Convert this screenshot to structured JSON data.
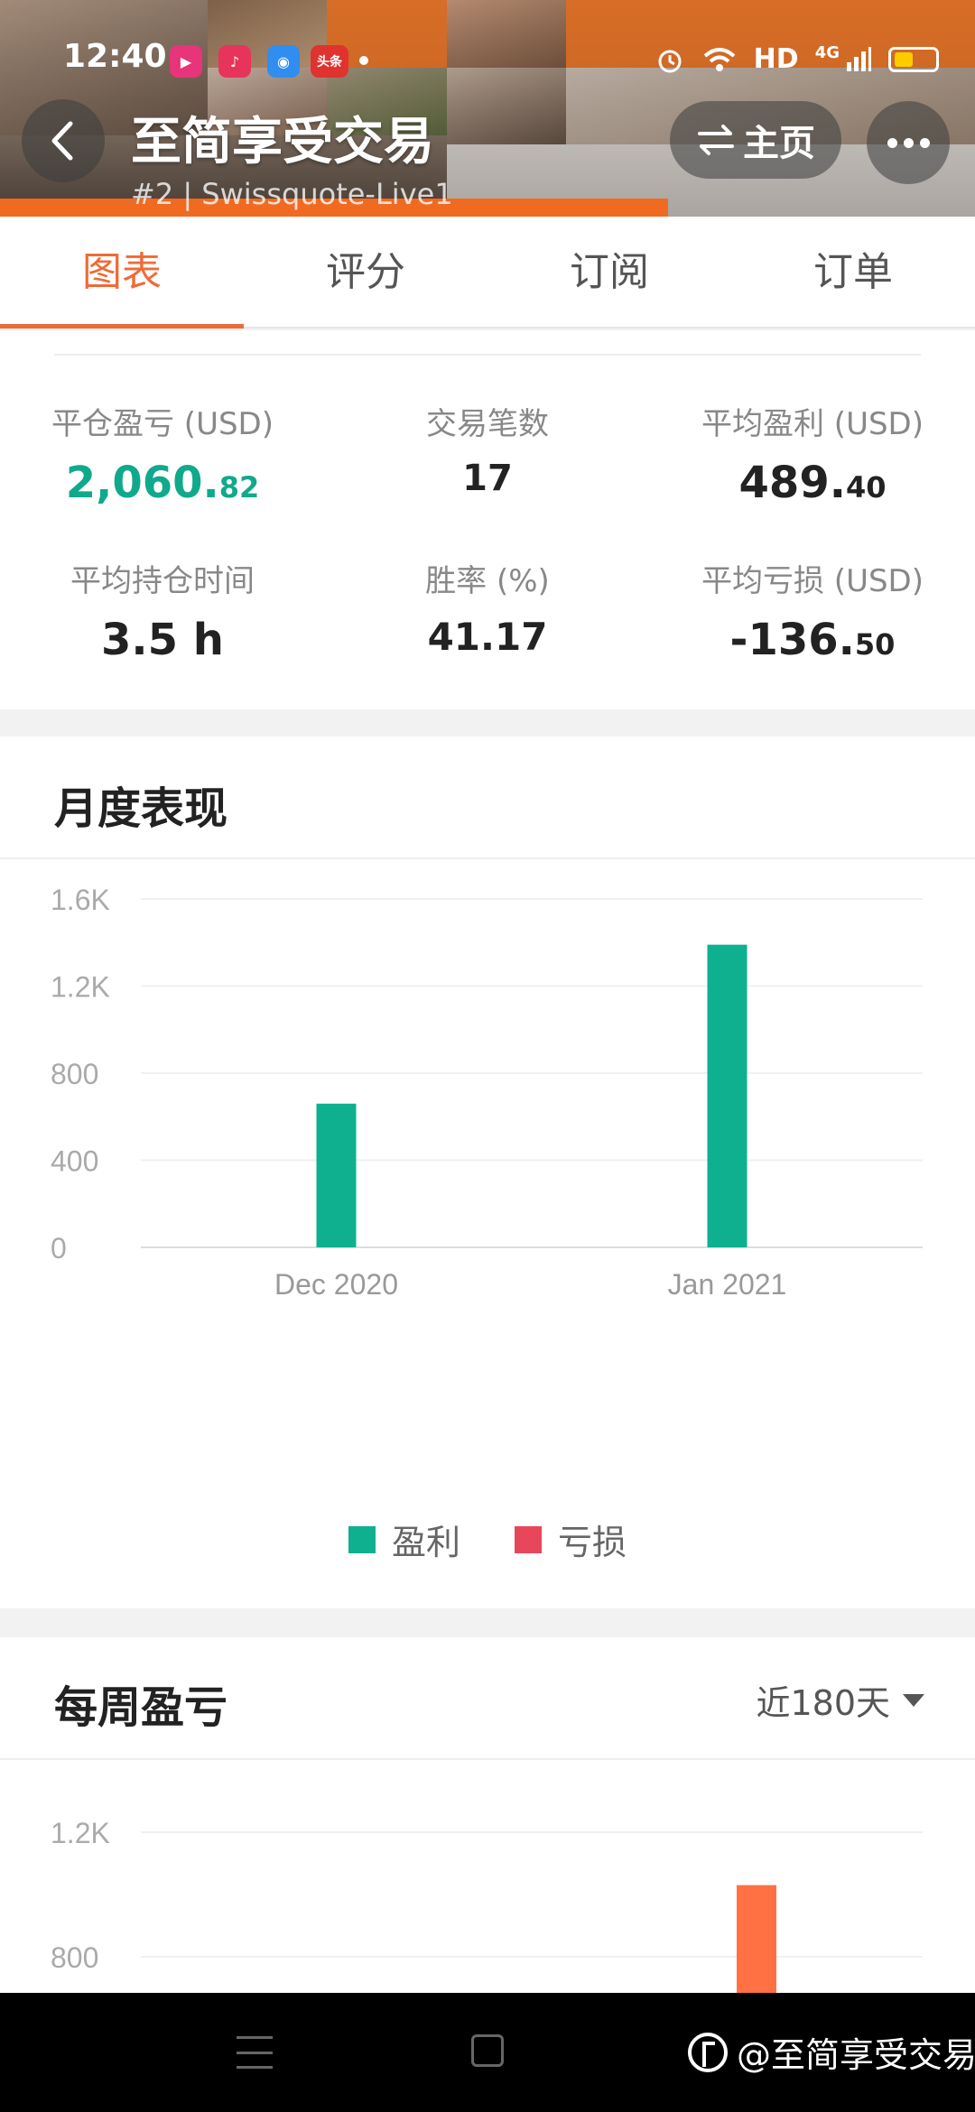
{
  "status_bar": {
    "time": "12:40",
    "network": "HD",
    "signal": "4G",
    "apps": [
      {
        "icon": "video-app-icon",
        "color": "#e8347a",
        "label": "▶"
      },
      {
        "icon": "music-app-icon",
        "color": "#e8345a",
        "label": "♪"
      },
      {
        "icon": "browser-app-icon",
        "color": "#2f8ef0",
        "label": "◉"
      },
      {
        "icon": "news-app-icon",
        "color": "#e0332f",
        "label": "头条"
      }
    ]
  },
  "header": {
    "title": "至简享受交易",
    "subtitle": "#2 | Swissquote-Live1",
    "home_label": "主页",
    "home_icon": "swap-icon"
  },
  "tabs": [
    {
      "label": "图表",
      "active": true
    },
    {
      "label": "评分",
      "active": false
    },
    {
      "label": "订阅",
      "active": false
    },
    {
      "label": "订单",
      "active": false
    }
  ],
  "stats": [
    {
      "label": "平仓盈亏 (USD)",
      "value_main": "2,060.",
      "value_small": "82",
      "color": "#10a98c"
    },
    {
      "label": "交易笔数",
      "value_main": "17",
      "value_small": ""
    },
    {
      "label": "平均盈利 (USD)",
      "value_main": "489.",
      "value_small": "40"
    },
    {
      "label": "平均持仓时间",
      "value_main": "3.5 h",
      "value_small": ""
    },
    {
      "label": "胜率 (%)",
      "value_main": "41.17",
      "value_small": ""
    },
    {
      "label": "平均亏损 (USD)",
      "value_main": "-136.",
      "value_small": "50"
    }
  ],
  "monthly": {
    "title": "月度表现",
    "legend": [
      {
        "label": "盈利",
        "color": "#0fb08f"
      },
      {
        "label": "亏损",
        "color": "#e8475a"
      }
    ]
  },
  "weekly": {
    "title": "每周盈亏",
    "period_label": "近180天",
    "bar_color": "#ff7143"
  },
  "watermark": {
    "text": "@至简享受交易"
  },
  "chart_data": [
    {
      "type": "bar",
      "title": "月度表现",
      "categories": [
        "Dec 2020",
        "Jan 2021"
      ],
      "series": [
        {
          "name": "盈利",
          "values": [
            660,
            1390
          ]
        },
        {
          "name": "亏损",
          "values": [
            0,
            0
          ]
        }
      ],
      "yticks": [
        "0",
        "400",
        "800",
        "1.2K",
        "1.6K"
      ],
      "ylim": [
        0,
        1600
      ],
      "grid": true,
      "legend": "bottom"
    },
    {
      "type": "bar",
      "title": "每周盈亏",
      "yticks": [
        "800",
        "1.2K"
      ],
      "series": [
        {
          "values": [
            1030
          ]
        }
      ],
      "grid": true
    }
  ]
}
